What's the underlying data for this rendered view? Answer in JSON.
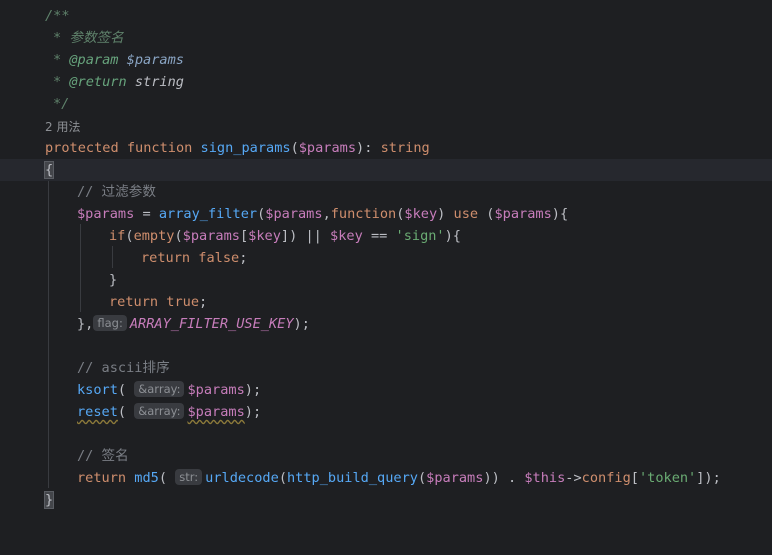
{
  "code": {
    "doc_open": "/**",
    "doc_star": "*",
    "doc_desc": "参数签名",
    "tag_param": "@param",
    "doc_param_var": "$params",
    "tag_return": "@return",
    "doc_return_type": "string",
    "doc_close": "*/",
    "usages": "2 用法",
    "kw_protected": "protected",
    "kw_function": "function",
    "fn_sign_params": "sign_params",
    "var_params": "$params",
    "type_string": "string",
    "open_brace": "{",
    "comment_filter": "// 过滤参数",
    "fn_array_filter": "array_filter",
    "var_key": "$key",
    "kw_use": "use",
    "kw_if": "if",
    "fn_empty": "empty",
    "str_sign": "'sign'",
    "kw_return": "return",
    "kw_false": "false",
    "kw_true": "true",
    "close_brace": "}",
    "hint_flag": "flag:",
    "const_filter_key": "ARRAY_FILTER_USE_KEY",
    "comment_sort": "// ascii排序",
    "fn_ksort": "ksort",
    "fn_reset": "reset",
    "hint_array": "&array:",
    "comment_sign": "// 签名",
    "fn_md5": "md5",
    "hint_str": "str:",
    "fn_urldecode": "urldecode",
    "fn_http_build_query": "http_build_query",
    "var_this": "$this",
    "prop_config": "config",
    "str_token": "'token'"
  }
}
